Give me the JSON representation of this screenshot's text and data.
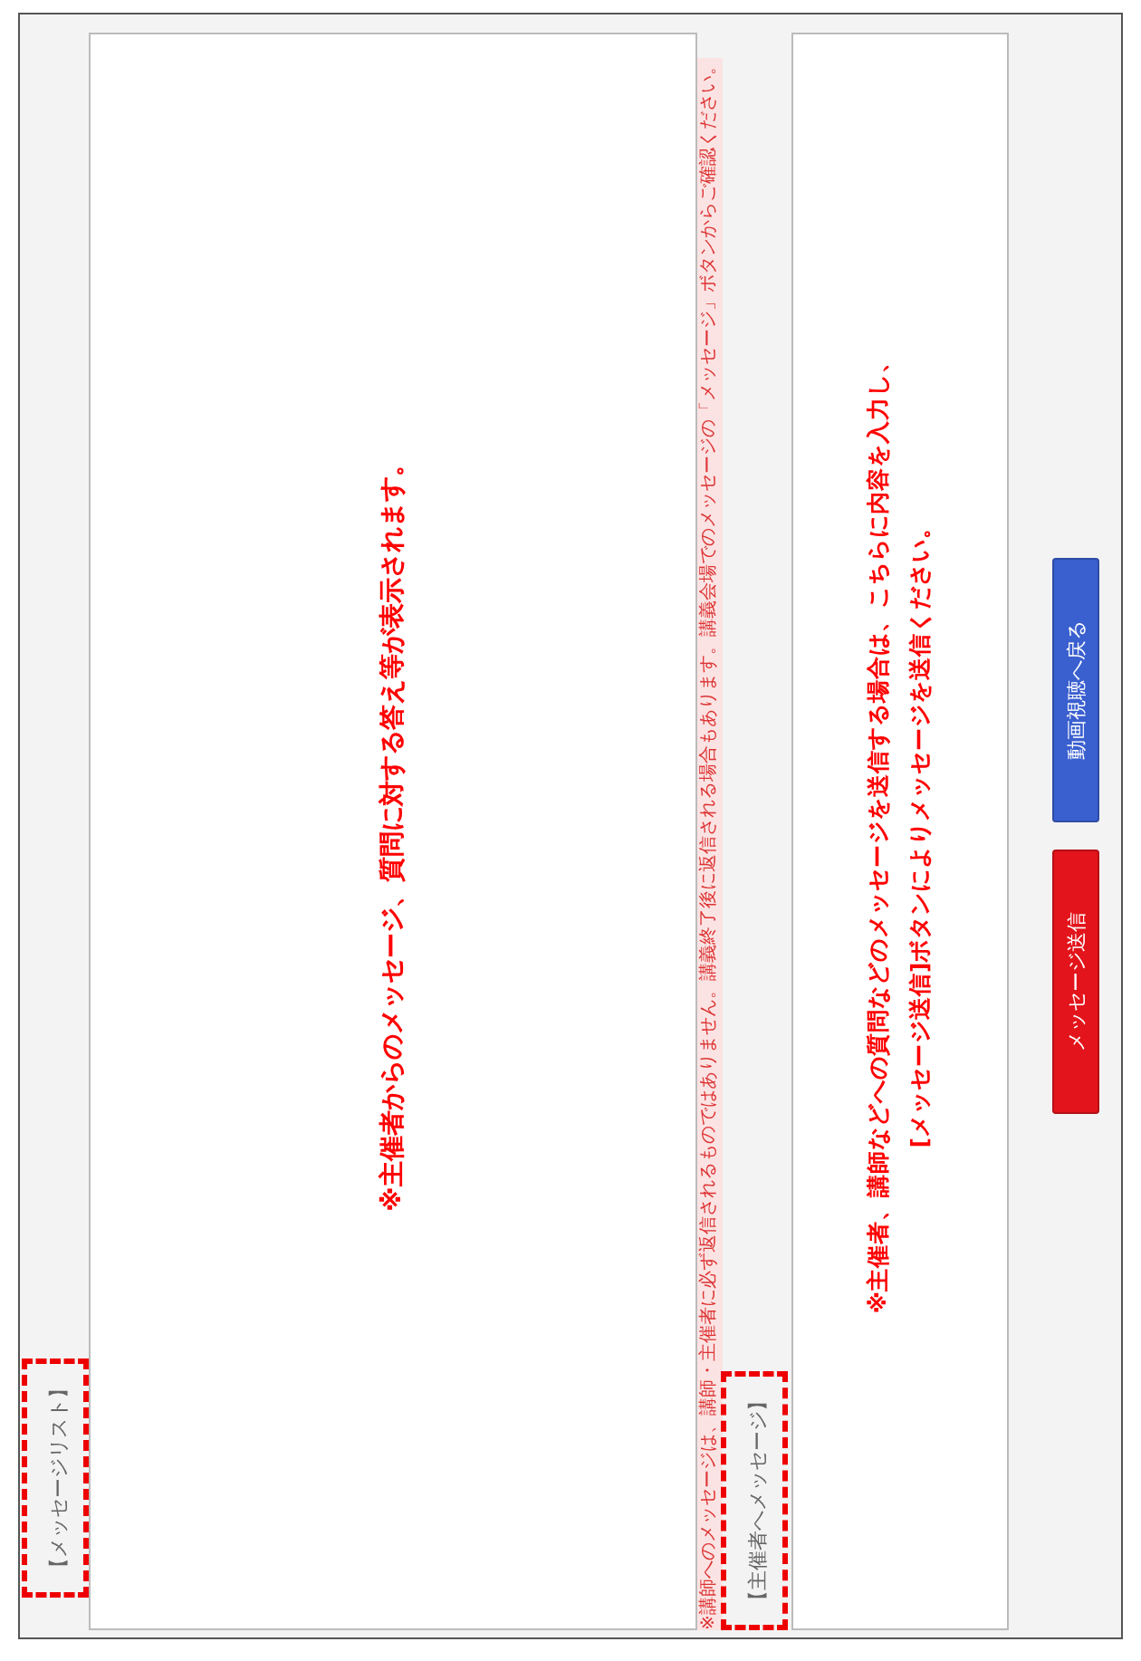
{
  "message_list": {
    "label": "【メッセージリスト】",
    "highlighted": true,
    "annotation": "※主催者からのメッセージ、質問に対する答え等が表示されます。",
    "notice": "※講師へのメッセージは、講師・主催者に必ず返信されるものではありません。講義終了後に返信される場合もあります。講義会場でのメッセージの「メッセージ」ボタンからご確認ください。"
  },
  "compose": {
    "label": "【主催者へメッセージ】",
    "highlighted": true,
    "annotation_lines": [
      "※主催者、講師などへの質問などのメッセージを送信する場合は、こちらに内容を入力し、",
      "[メッセージ送信]ボタンによりメッセージを送信ください。"
    ]
  },
  "buttons": [
    {
      "label": "メッセージ送信",
      "kind": "send"
    },
    {
      "label": "動画視聴へ戻る",
      "kind": "back"
    }
  ]
}
